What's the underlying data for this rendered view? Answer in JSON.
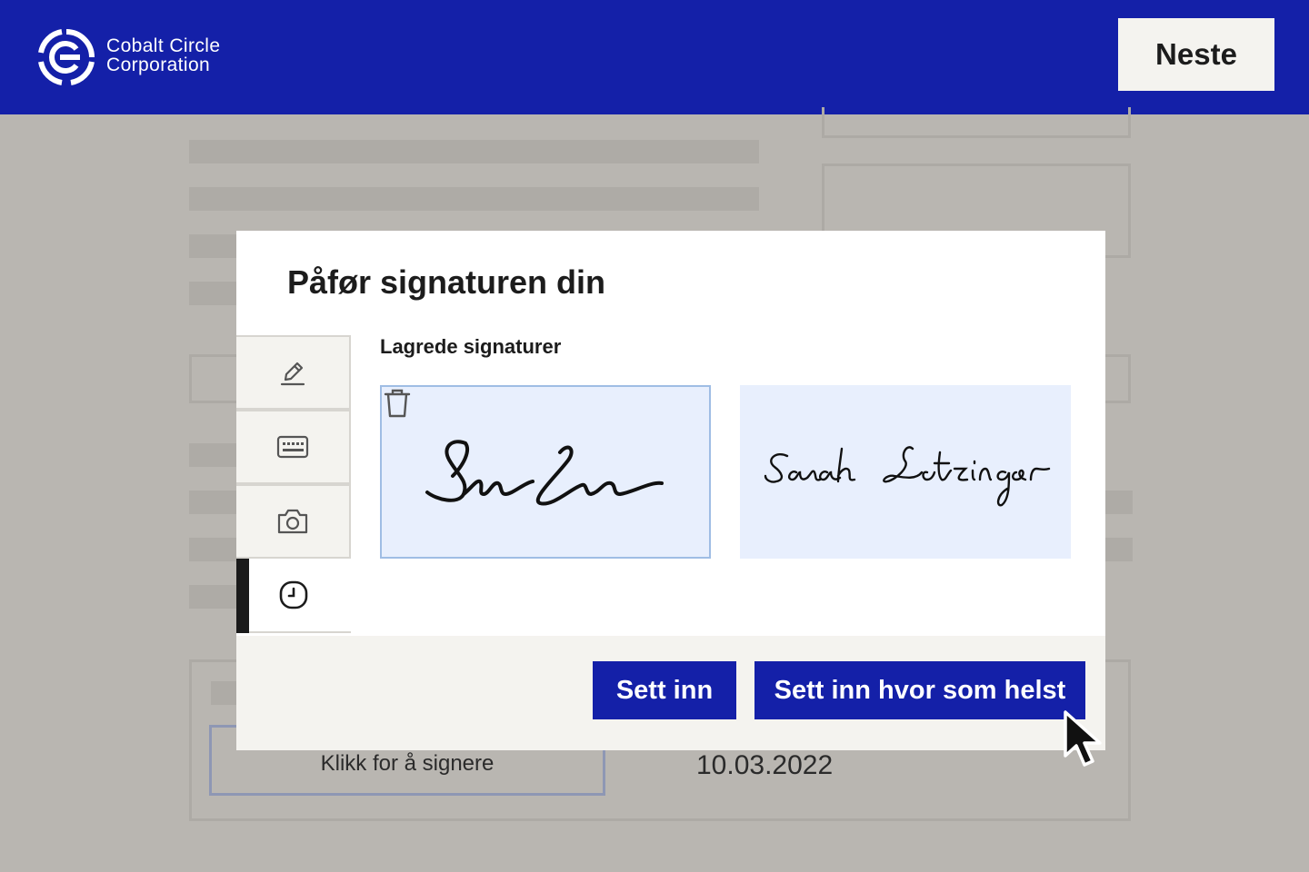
{
  "header": {
    "brand_line1": "Cobalt Circle",
    "brand_line2": "Corporation",
    "next_label": "Neste",
    "color": "#1420a8"
  },
  "document": {
    "sign_field_label": "Klikk for å signere",
    "date": "10.03.2022"
  },
  "modal": {
    "title": "Påfør signaturen din",
    "tabs": [
      {
        "icon": "pencil-icon",
        "active": false
      },
      {
        "icon": "keyboard-icon",
        "active": false
      },
      {
        "icon": "camera-icon",
        "active": false
      },
      {
        "icon": "clock-icon",
        "active": true
      }
    ],
    "saved_label": "Lagrede signaturer",
    "signatures": [
      {
        "type": "initials",
        "selected": true,
        "icon": "trash-icon"
      },
      {
        "type": "full-name",
        "selected": false
      }
    ],
    "buttons": {
      "insert": "Sett inn",
      "insert_anywhere": "Sett inn hvor som helst"
    }
  }
}
